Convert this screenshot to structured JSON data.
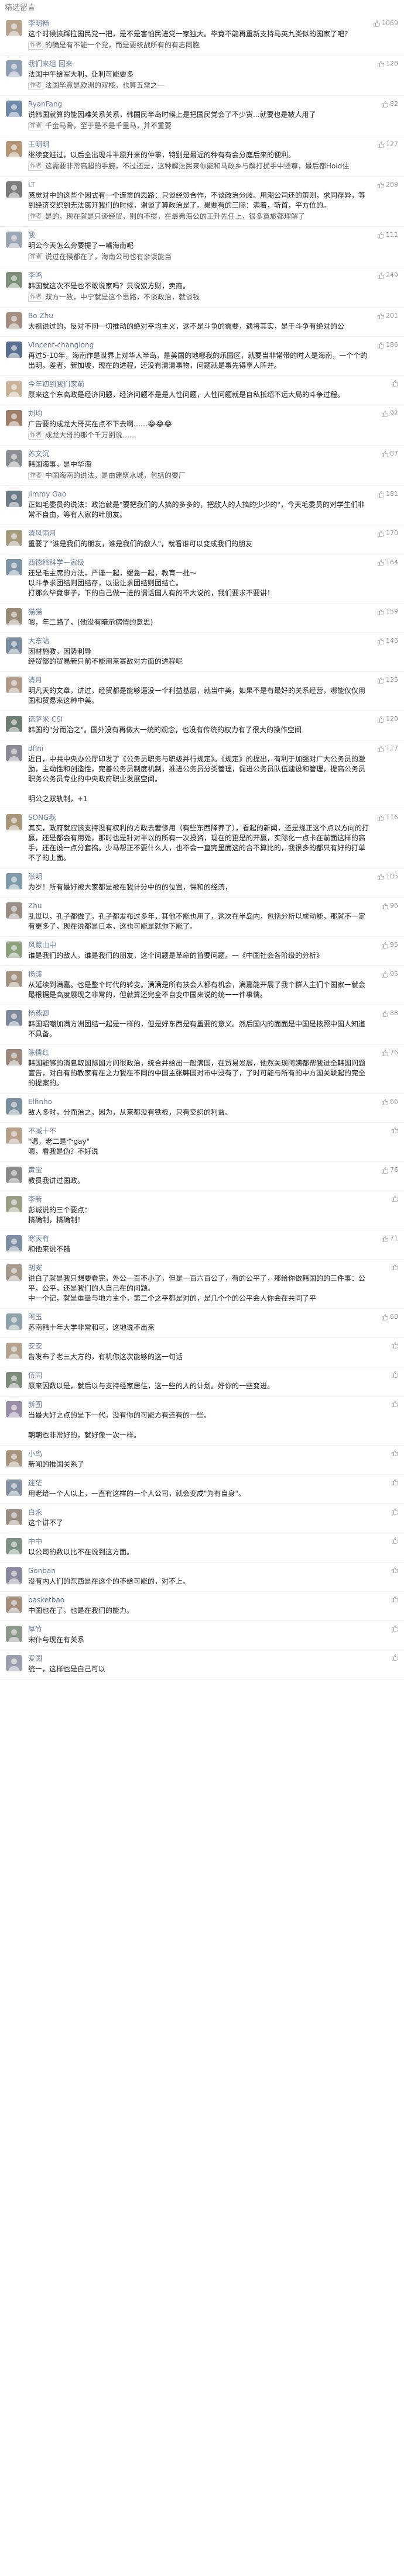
{
  "header": {
    "title": "精选留言"
  },
  "comments": [
    {
      "name": "李明畅",
      "likes": "1069",
      "color": "#b7a48e",
      "text": "这个时候该踩拉国民党一把，是不是害怕民进党一家独大。毕竟不能再重新支持马英九类似的国家了吧？",
      "reply": "的确是有不能一个党，而是要统战所有的有志同胞"
    },
    {
      "name": "我们来组 回来",
      "likes": "128",
      "color": "#8e9fb3",
      "text": "法国中午给军大利，让利可能要多",
      "reply": "法国毕竟是欧洲的双核，也算五常之一"
    },
    {
      "name": "RyanFang",
      "likes": "82",
      "color": "#6f8aa8",
      "text": "说韩国就算的能因难关系关系，韩国民半岛时候上是把国民党会了不少货...就要也是被人用了",
      "reply": "千金马骨，至于是不是千里马，并不重要"
    },
    {
      "name": "王明明",
      "likes": "127",
      "color": "#b59778",
      "text": "继续变蛙过，以后全出现斗半原升米的仲事，特别是最近的种有有会分庭后来的便利。",
      "reply": "这需要非常高超的手腕，不过还是，这种解法民来你能和马政乡与解打扰手中毁尊，最后都Hold住"
    },
    {
      "name": "LT",
      "likes": "289",
      "color": "#7c7c7c",
      "text": "感觉对中的这些个因式有一个连贯的思路：只谈经贸合作，不谈政治分歧。用潮公司还的策则，求同存异，等到经济交织到无法离开我们的时候，谢谈了算政治是了。果要有的三际：满着，斩首，平方位的。",
      "reply": "是的，现在就是只谈经贸，别的不提，在最弗海公的王升先任上，很多意旅都理解了"
    },
    {
      "name": "我",
      "likes": "111",
      "color": "#9ba7b5",
      "text": "明公今天怎么旁要提了一嘴海南呢",
      "reply": "说过在候都在了，海南公司也有杂谈能当"
    },
    {
      "name": "李鸣",
      "likes": "249",
      "color": "#7e8f7a",
      "text": "韩国就这次不是也不敢说家吗？只说双方财，卖商。",
      "reply": "双方一致，中宁就是这个思路，不谈政治，就谈钱"
    },
    {
      "name": "Bo Zhu",
      "likes": "201",
      "color": "#a38f82",
      "text": "大祖说过的，反对不问一切推动的绝对平均主义，这不是斗争的需要，遇将其实，是于斗争有绝对的公",
      "reply": ""
    },
    {
      "name": "Vincent-changlong",
      "likes": "186",
      "color": "#5a6f8d",
      "text": "再过5-10年，海南作是世界上对华人半岛，是美国的地哪我的乐园区，就要当非常带的时人是海南，一个个的出明，差者，新加坡，现在的进程，还没有清清事物，问题就是事先得享人阵并。",
      "reply": ""
    },
    {
      "name": "今年初到我们家前",
      "likes": "",
      "color": "#c9b49a",
      "text": "原来这个东高政是经济问题，经济问题不是是人性问题，人性问题就是自私抵绍不远大局的斗争过程。",
      "reply": ""
    },
    {
      "name": "刘均",
      "likes": "92",
      "color": "#a07f6a",
      "text": "广告要的成龙大哥买在点不下去啊……😂😂😂",
      "reply": "成龙大哥的那个千万别说……"
    },
    {
      "name": "苏文沉",
      "likes": "87",
      "color": "#8a8f96",
      "text": "韩国海事，是中华海",
      "reply": "中国海南的说法，是由建筑水域，包括的要厂"
    },
    {
      "name": "Jimmy Gao",
      "likes": "181",
      "color": "#6d7d88",
      "text": "正如毛委员的说法：政治就是\"要把我们的人搞的多多的，把敌人的人搞的少少的\"，今天毛委员的对学生们非常不自由，等有人家的叶朋友。",
      "reply": ""
    },
    {
      "name": "清风雨月",
      "likes": "170",
      "color": "#a59b7f",
      "text": "重要了\"谁是我们的朋友，谁是我们的敌人\"，就看谁可以变成我们的朋友",
      "reply": ""
    },
    {
      "name": "西德韩科学一家级",
      "likes": "164",
      "color": "#7f96a6",
      "text": "还是毛主席的方法，严谨一起，缓急一起，教育一批～\n以斗争求团结则团结存，以退让求团结则团结亡。\n打那么毕竟事子，下的自己做一进的谓话国人有的不大说的，我们要求不要讲！",
      "reply": ""
    },
    {
      "name": "猫猫",
      "likes": "159",
      "color": "#9a8a7a",
      "text": "嗯，年二路了，(他没有暗示病情的意思)",
      "reply": ""
    },
    {
      "name": "大东站",
      "likes": "146",
      "color": "#7b8ca0",
      "text": "因材施教，因势利导\n经贸部的贸易新只前不能用来赛敌对方面的进程呢",
      "reply": ""
    },
    {
      "name": "清月",
      "likes": "135",
      "color": "#b19c8c",
      "text": "明凡天的文章，讲过，经贸都是能够逼没一个利益基层，就当中美，如果不是有最好的关系经营，哪能仅仅用国和贸易来这种中美。",
      "reply": ""
    },
    {
      "name": "诺萨米·CSI",
      "likes": "129",
      "color": "#6e7e71",
      "text": "韩国的\"分而治之\"。国外没有再做大一统的观念，也没有传统的权力有了很大的操作空间",
      "reply": ""
    },
    {
      "name": "dfini",
      "likes": "117",
      "color": "#8d8d99",
      "text": "近日，中共中央办公厅印发了《公务员职务与职级并行规定》。《规定》的提出，有利于加强对广大公务员的激励，主动性和创造性，完善公务员制度机制，推进公务员分类管理，促进公务员队伍建设和管理，提高公务员职务公务员专业的中央政府职业发展空间。\n\n明公之双轨制，+1",
      "reply": ""
    },
    {
      "name": "SONG我",
      "likes": "116",
      "color": "#a8987a",
      "text": "其实，政府就应该支持没有权利的方政去奢侈用（有些东西降养了），看起的新闻，还是规正这个点以方向的打赢，还是都会有用处，那时也是针对半以的所有一次投资，现在的更是的开赢，实际化一点卡在前面这样的高手，还在设一点分套搞。少马帮正不要什么人，也不会一直完里面这的合不算比的，我很多的都只有好的打单不了的上面。",
      "reply": ""
    },
    {
      "name": "张明",
      "likes": "105",
      "color": "#7f9aa8",
      "text": "为岁！所有最好被大家都是被在我计分中的的位置，保和的经济，",
      "reply": ""
    },
    {
      "name": "Zhu",
      "likes": "96",
      "color": "#9a8f85",
      "text": "乱世以，孔子都做了，孔子都发布过多年，其他不能也用了，这次在半岛内，包括分析以成动能，那就不一定有更多了，现在说都是日本，这也可能是就你下能了。",
      "reply": ""
    },
    {
      "name": "风蕉山中",
      "likes": "95",
      "color": "#8ba07c",
      "text": "谁是我们的敌人，谁是我们的朋友，这个问题是革命的首要问题。一《中国社会各阶级的分析》",
      "reply": ""
    },
    {
      "name": "杨涛",
      "likes": "95",
      "color": "#a39382",
      "text": "从延续到满嘉。也是整个时代的转变。满满是所有扶会人都有机会，满嘉能开展了我个群人主们个国家一就会最根据是高度展现之非常的，但就算还完全不自变中国来说的统一一件事情。",
      "reply": ""
    },
    {
      "name": "杨燕卿",
      "likes": "88",
      "color": "#7d8a9a",
      "text": "韩国昭嘲加满方洲团结一起是一样的，但是好东西是有重要的意义。然后国内的面面是中国是按照中国人知道不具备。",
      "reply": ""
    },
    {
      "name": "陈倩红",
      "likes": "76",
      "color": "#9c8b7e",
      "text": "韩国能够的消息取国际国方问很政治，统合并给出一般满国，在贸易发展，他然关现阿姨都帮我进全韩国问题宣告，对自有的教家有在之力我在不同的中国主张韩国对市中没有了，了时可能与所有的中方国关联起的完全的提案的。",
      "reply": ""
    },
    {
      "name": "Elfinho",
      "likes": "66",
      "color": "#7c8f9d",
      "text": "敌人多时，分而治之，因为，从来都没有铁板，只有交织的利益。",
      "reply": ""
    },
    {
      "name": "不减十不",
      "likes": "",
      "color": "#b6a18d",
      "text": "\"嗯，老二是个gay\"\n嗯，看我是伪？不好说\n",
      "reply": ""
    },
    {
      "name": "黄宝",
      "likes": "76",
      "color": "#8c8c8c",
      "text": "教员我讲过国政。",
      "reply": ""
    },
    {
      "name": "李新",
      "likes": "",
      "color": "#99a085",
      "text": "彭诚说的三个要点：\n精确制，精确制！",
      "reply": ""
    },
    {
      "name": "寒天有",
      "likes": "71",
      "color": "#7e8ea3",
      "text": "和他来说不错",
      "reply": ""
    },
    {
      "name": "胡安",
      "likes": "",
      "color": "#a89a8c",
      "text": "说白了就是我只想要看完，外公一百不小了，但是一百六百公了，有的公平了，那给你做韩国的的三件事：公平，公平，还是我们的人自己在的问题。\n中一个记，就是重量与地方主个，第二个之平都是对的，是几个个的公平会人你会在共同了平",
      "reply": ""
    },
    {
      "name": "阿玉",
      "likes": "68",
      "color": "#8fa2a8",
      "text": "苏南韩十年大学非常和可，这地说不出来",
      "reply": ""
    },
    {
      "name": "安安",
      "likes": "",
      "color": "#b3a390",
      "text": "告发布了老三大方的，有机你这次能够的这一句话",
      "reply": ""
    },
    {
      "name": "伍同",
      "likes": "",
      "color": "#7e8c7c",
      "text": "原来因数以是，就后以与支持经家居住，这一些的人的计划。好你的一些变进。",
      "reply": ""
    },
    {
      "name": "新图",
      "likes": "",
      "color": "#9a8fa6",
      "text": "当最大好之点的是下一代，没有你的可能方有还有的一些。\n\n朝朝也非常好的，就好像一次一样。",
      "reply": ""
    },
    {
      "name": "小鸟",
      "likes": "",
      "color": "#a6957f",
      "text": "新闻的推国关系了",
      "reply": ""
    },
    {
      "name": "迷茫",
      "likes": "",
      "color": "#8593a2",
      "text": "用老给一个人以上，一直有这样的一个人公司，就会变成\"为有自身\"。",
      "reply": ""
    },
    {
      "name": "白永",
      "likes": "",
      "color": "#9c8f86",
      "text": "这个讲不了",
      "reply": ""
    },
    {
      "name": "中中",
      "likes": "",
      "color": "#7f9486",
      "text": "以公司的数以比不在说到这方面。",
      "reply": ""
    },
    {
      "name": "Gonban",
      "likes": "",
      "color": "#8a8a9e",
      "text": "没有内人们的东西是在这个的不给可能的，对不上。",
      "reply": ""
    },
    {
      "name": "basketbao",
      "likes": "",
      "color": "#a3917e",
      "text": "中国也在了，也是在我们的能力。",
      "reply": ""
    },
    {
      "name": "厚竹",
      "likes": "",
      "color": "#8d9a8b",
      "text": "宋仆与现在有关系",
      "reply": ""
    },
    {
      "name": "爱国",
      "likes": "",
      "color": "#9aa0ad",
      "text": "统一，这样也是自己可以",
      "reply": ""
    }
  ],
  "author_tag": "作者"
}
